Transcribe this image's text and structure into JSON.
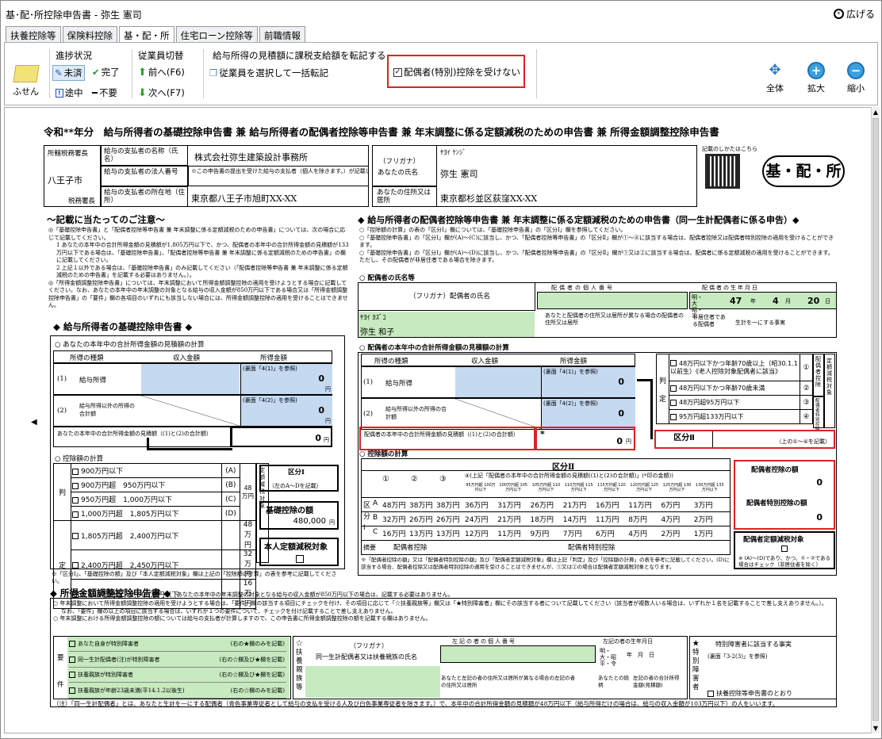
{
  "window": {
    "title": "基･配･所控除申告書 - 弥生 憲司",
    "expand_label": "広げる"
  },
  "tabs": [
    "扶養控除等",
    "保険料控除",
    "基・配・所",
    "住宅ローン控除等",
    "前職情報"
  ],
  "ribbon": {
    "sticky_label": "ふせん",
    "progress_title": "進捗状況",
    "progress_items": [
      "未済",
      "完了",
      "途中",
      "不要"
    ],
    "employee_title": "従業員切替",
    "prev_label": "前へ(F6)",
    "next_label": "次へ(F7)",
    "transfer_title": "給与所得の見積額に課税支給額を転記する",
    "transfer_button": "従業員を選択して一括転記",
    "spouse_checkbox_label": "配偶者(特別)控除を受けない",
    "spouse_checkbox_checked": true,
    "zoom_buttons": [
      "全体",
      "拡大",
      "縮小"
    ]
  },
  "form": {
    "title": "令和**年分　給与所得者の基礎控除申告書 兼 給与所得者の配偶者控除等申告書 兼 年末調整に係る定額減税のための申告書 兼 所得金額調整控除申告書",
    "tax_office_label": "所轄税務署長",
    "tax_office": "八王子市",
    "tax_office_suffix": "税務署長",
    "payer_name_label": "給与の支払者の名称（氏名）",
    "payer_name": "株式会社弥生建築設計事務所",
    "payer_corp_label": "給与の支払者の法人番号",
    "payer_corp_note": "※この申告書の提出を受けた給与の支払者（個人を除きます。）が記載してください。",
    "payer_addr_label": "給与の支払者の所在地（住所）",
    "payer_addr": "東京都八王子市旭町XX-XX",
    "furigana_label": "（フリガナ）",
    "your_name_label": "あなたの氏名",
    "your_furigana": "ﾔﾖｲ ｹﾝｼﾞ",
    "your_name": "弥生 憲司",
    "your_addr_label": "あなたの住所又は居所",
    "your_addr": "東京都杉並区荻窪XX-XX",
    "qr_caption": "記載のしかたはこちら",
    "stamp": "基・配・所",
    "notes_title": "～記載に当たってのご注意～",
    "notes": [
      "◎「基礎控除申告書」と「配偶者控除等申告書 兼 年末調整に係る定額減税のための申告書」については、次の場合に応じて記載してください。",
      "1 あなたの本年中の合計所得金額の見積額が1,805万円以下で、かつ、配偶者の本年中の合計所得金額の見積額が133万円以下である場合は、「基礎控除申告書」、「配偶者控除等申告書 兼 年末調整に係る定額減税のための申告書」の欄に記載してください。",
      "2 上記１以外である場合は、「基礎控除申告書」のみ記載してください（「配偶者控除等申告書 兼 年末調整に係る定額減税のための申告書」を記載する必要はありません。）。",
      "◎「所得金額調整控除申告書」については、年末調整において所得金額調整控除の適用を受けようとする場合に記載してください。なお、あなたの本年中の年末調整の対象となる給与の収入金額が850万円以下である場合又は「所得金額調整控除申告書」の「要件」欄の各項目のいずれにも該当しない場合には、所得金額調整控除の適用を受けることはできません。"
    ],
    "basic": {
      "title": "◆ 給与所得者の基礎控除申告書 ◆",
      "estimate_title": "○ あなたの本年中の合計所得金額の見積額の計算",
      "headers": [
        "所得の種類",
        "収入金額",
        "所得金額"
      ],
      "row1_label": "給与所得",
      "row2_label": "給与所得以外の所得の合計額",
      "row1_ref": "(裏面「4(1)」を参照)",
      "row2_ref": "(裏面「4(2)」を参照)",
      "row1_value": "0",
      "row2_value": "0",
      "total_label": "あなたの本年中の合計所得金額の見積額（(1)と(2)の合計額）",
      "total_value": "0",
      "yen": "円",
      "deduction_title": "○ 控除額の計算",
      "deduction_rows": [
        {
          "range": "900万円以下",
          "code": "(A)",
          "amount": ""
        },
        {
          "range": "900万円超　950万円以下",
          "code": "(B)",
          "amount": "48万円"
        },
        {
          "range": "950万円超　1,000万円以下",
          "code": "(C)",
          "amount": ""
        },
        {
          "range": "1,000万円超　1,805万円以下",
          "code": "(D)",
          "amount": ""
        },
        {
          "range": "1,805万円超　2,400万円以下",
          "code": "",
          "amount": "48万円"
        },
        {
          "range": "2,400万円超　2,450万円以下",
          "code": "",
          "amount": "32万円"
        },
        {
          "range": "2,450万円超　2,500万円以下",
          "code": "",
          "amount": "16万円"
        }
      ],
      "kubun1_label": "区分Ⅰ",
      "kubun1_note": "（左のA～Dを記載）",
      "basic_deduction_label": "基礎控除の額",
      "basic_deduction_value": "480,000",
      "fixed_tax_label": "本人定額減税対象",
      "side_label": "定額減税対象",
      "hantei": "判定"
    },
    "spouse": {
      "title": "◆ 給与所得者の配偶者控除等申告書 兼 年末調整に係る定額減税のための申告書（同一生計配偶者に係る申告）◆",
      "intro": [
        "○「控除額の計算」の表の「区分Ⅰ」欄については、「基礎控除申告書」の「区分Ⅰ」欄を参照してください。",
        "○「基礎控除申告書」の「区分Ⅰ」欄が(A)～(C)に該当し、かつ、「配偶者控除等申告書」の「区分Ⅱ」欄が①～④に該当する場合は、配偶者控除又は配偶者特別控除の適用を受けることができます。",
        "○「基礎控除申告書」の「区分Ⅰ」欄が(A)～(D)に該当し、かつ、「配偶者控除等申告書」の「区分Ⅱ」欄が①又は②に該当する場合は、配偶者に係る定額減税の適用を受けることができます。ただし、その配偶者が非居住者である場合を除きます。"
      ],
      "name_section": "○ 配偶者の氏名等",
      "name_furigana_label": "（フリガナ）配偶者の氏名",
      "my_number_label": "配偶者の個人番号",
      "birth_label": "配偶者の生年月日",
      "era": "明・大昭・平",
      "birth_year": "47",
      "birth_month": "4",
      "birth_day": "20",
      "year_label": "年",
      "month_label": "月",
      "day_label": "日",
      "furigana": "ﾔﾖｲ ｶｽﾞｺ",
      "name": "弥生 和子",
      "address_note": "あなたと配偶者の住所又は居所が異なる場合の配偶者の住所又は居所",
      "nonresident_label": "非居住者である配偶者",
      "living_label": "生計を一にする事実",
      "estimate_title": "○ 配偶者の本年中の合計所得金額の見積額の計算",
      "headers": [
        "所得の種類",
        "収入金額",
        "所得金額"
      ],
      "row1_label": "給与所得",
      "row2_label": "給与所得以外の所得の合計額",
      "row1_ref": "(裏面「4(1)」を参照)",
      "row2_ref": "(裏面「4(2)」を参照)",
      "row1_value": "0",
      "row2_value": "0",
      "total_label": "配偶者の本年中の合計所得金額の見積額（(1)と(2)の合計額）",
      "total_value": "0",
      "asterisk": "*",
      "judge_rows": [
        {
          "label": "48万円以下かつ年齢70歳以上（昭30.1.1以前生）《老人控除対象配偶者に該当》",
          "code": "①"
        },
        {
          "label": "48万円以下かつ年齢70歳未満",
          "code": "②"
        },
        {
          "label": "48万円超95万円以下",
          "code": "③"
        },
        {
          "label": "95万円超133万円以下",
          "code": "④"
        }
      ],
      "judge_side1": "配偶者控除",
      "judge_side2": "配偶者特別控除",
      "judge_side3": "定額減税対象",
      "kubun2_label": "区分Ⅱ",
      "kubun2_note": "（上の①～④を記載）",
      "calc_title": "○ 控除額の計算",
      "calc_kubun2": "区分Ⅱ",
      "calc_col_heads": [
        "①",
        "②",
        "③"
      ],
      "calc_col4_head": "④(上記「配偶者の本年中の合計所得金額の見積額((1)と(2)の合計額)」(*印の金額))",
      "calc_subheads": [
        "95万円超 100万円以下",
        "100万円超 105万円以下",
        "105万円超 110万円以下",
        "110万円超 115万円以下",
        "115万円超 120万円以下",
        "120万円超 125万円以下",
        "125万円超 130万円以下",
        "130万円超 133万円以下"
      ],
      "calc_rows": [
        {
          "k": "A",
          "v": [
            "48万円",
            "38万円",
            "38万円",
            "36万円",
            "31万円",
            "26万円",
            "21万円",
            "16万円",
            "11万円",
            "6万円",
            "3万円"
          ]
        },
        {
          "k": "B",
          "v": [
            "32万円",
            "26万円",
            "26万円",
            "24万円",
            "21万円",
            "18万円",
            "14万円",
            "11万円",
            "8万円",
            "4万円",
            "2万円"
          ]
        },
        {
          "k": "C",
          "v": [
            "16万円",
            "13万円",
            "13万円",
            "12万円",
            "11万円",
            "9万円",
            "7万円",
            "6万円",
            "4万円",
            "2万円",
            "1万円"
          ]
        }
      ],
      "kubun1_side": "区分Ⅰ",
      "summary_label": "摘要",
      "summary_col1": "配偶者控除",
      "summary_col2": "配偶者特別控除",
      "footnote": "※「配偶者控除の額」又は「配偶者特別控除の額」及び「配偶者定額減税対象」欄は上記「判定」及び「控除額の計算」の表を参考に記載してください。(D)に該当する場合、配偶者控除又は配偶者特別控除の適用を受けることはできませんが、①又は②の場合は配偶者定額減税対象となります。",
      "deduction_label": "配偶者控除の額",
      "deduction_value": "0",
      "special_label": "配偶者特別控除の額",
      "special_value": "0",
      "fixed_tax_label": "配偶者定額減税対象",
      "fixed_tax_note": "※ (A)～(D)であり、かつ、①・②である場合はチェック（非居住者を除く）"
    },
    "basic_footnote": "※「区分Ⅰ」、「基礎控除の額」及び「本人定額減税対象」欄は上記の「控除額の計算」の表を参考に記載してください。",
    "adjust": {
      "title": "◆ 所得金額調整控除申告書 ◆",
      "title_note": "あなたの本年中の年末調整の対象となる給与の収入金額が850万円以下の場合は、記載する必要はありません。",
      "notes": [
        "○ 年末調整において所得金額調整控除の適用を受けようとする場合は、「要件」欄の該当する項目にチェックを付け、その項目に応じて「☆扶養親族等」欄又は「★特別障害者」欄にその該当する者について記載してください（該当者が複数人いる場合は、いずれか１名を記載することで差し支えありません。）。",
        "なお、「要件」欄の以上の項目に該当する場合は、いずれか１つの要件について、チェックを付け記載することで差し支えありません。",
        "○ 年末調整における所得金額調整控除の額については給与の支払者が計算しますので、この申告書に所得金額調整控除の額を記載する欄はありません。"
      ],
      "requirement_label": "要件",
      "requirements": [
        {
          "text": "あなた自身が特別障害者",
          "note": "(右の★欄のみを記載)"
        },
        {
          "text": "同一生計配偶者(注)が特別障害者",
          "note": "(右の☆欄及び★欄を記載)"
        },
        {
          "text": "扶養親族が特別障害者",
          "note": "(右の☆欄及び★欄を記載)"
        },
        {
          "text": "扶養親族が年齢23歳未満(平14.1.2以後生)",
          "note": "(右の☆欄のみを記載)"
        }
      ],
      "dependents_side": "☆扶養親族等",
      "furigana_label": "（フリガナ）",
      "dependent_name_label": "同一生計配偶者又は扶養親族の氏名",
      "my_number_label": "左記の者の個人番号",
      "birth_label": "左記の者の生年月日",
      "era": "明・大・昭平・令",
      "ymd": "年　月　日",
      "addr_note": "あなたと左記の者の住所又は居所が異なる場合の左記の者の住所又は居所",
      "relation_label": "あなたとの続柄",
      "income_label": "左記の者の合計所得金額(見積額)",
      "yen": "円",
      "special_side": "★特別障害者",
      "special_title": "特別障害者に該当する事実",
      "special_ref": "(裏面「3-2(3)」を参照)",
      "special_check": "扶養控除等申告書のとおり",
      "bottom_note": "（注）「同一生計配偶者」とは、あなたと生計を一にする配偶者（青色事業専従者として給与の支払を受ける人及び白色事業専従者を除きます。）で、本年中の合計所得金額の見積額が48万円以下（給与所得だけの場合は、給与の収入金額が103万円以下）の人をいいます。"
    }
  }
}
